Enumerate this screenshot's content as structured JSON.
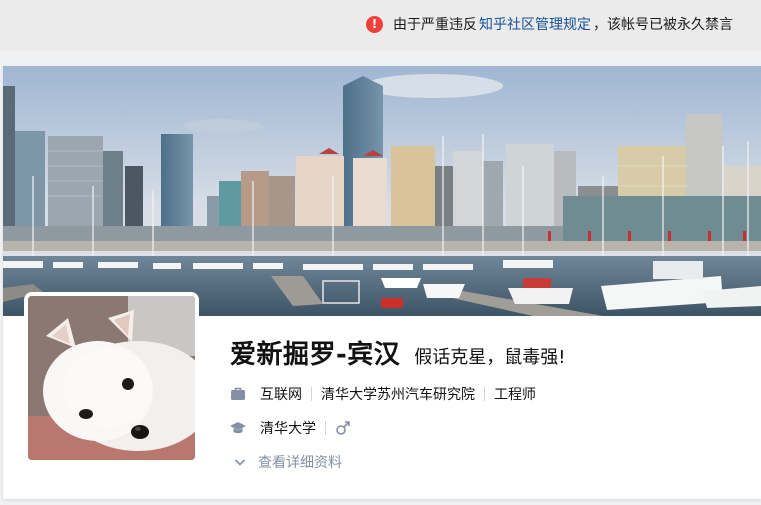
{
  "notice": {
    "text_before": "由于严重违反",
    "link": "知乎社区管理规定",
    "text_after": "，该帐号已被永久禁言",
    "icon": "exclamation-circle-icon",
    "icon_color": "#f1403c",
    "link_color": "#175199"
  },
  "profile": {
    "name": "爱新掘罗-宾汉",
    "headline": "假话克星，鼠毒强!",
    "industry": "互联网",
    "company": "清华大学苏州汽车研究院",
    "job": "工程师",
    "school": "清华大学",
    "gender_icon": "male-icon",
    "more_label": "查看详细资料",
    "icons": {
      "industry": "briefcase-icon",
      "school": "graduation-cap-icon",
      "more": "chevron-down-icon"
    }
  },
  "colors": {
    "secondary_text": "#8590a6",
    "icon_gray": "#8590a6"
  }
}
